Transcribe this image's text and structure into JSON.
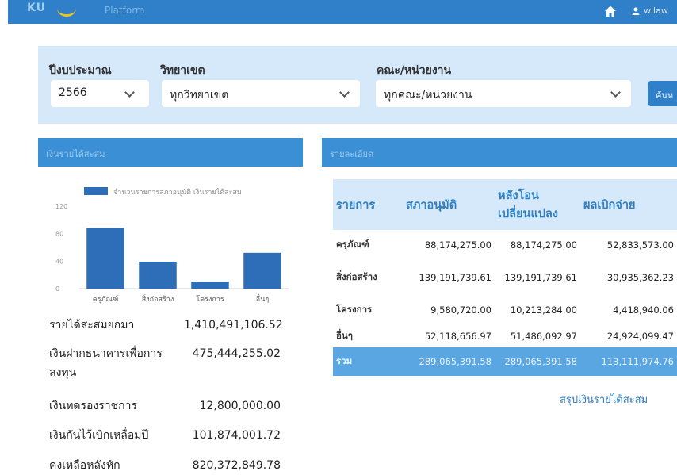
{
  "app": {
    "logo_text": "KU",
    "platform_label": "Platform",
    "user_name": "wilaw"
  },
  "filters": {
    "fiscal_year": {
      "label": "ปีงบประมาณ",
      "value": "2566"
    },
    "campus": {
      "label": "วิทยาเขต",
      "value": "ทุกวิทยาเขต"
    },
    "faculty": {
      "label": "คณะ/หน่วยงาน",
      "value": "ทุกคณะ/หน่วยงาน"
    },
    "search_label": "ค้นห"
  },
  "income_card": {
    "title": "เงินรายได้สะสม"
  },
  "detail_card": {
    "title": "รายละเอียด"
  },
  "chart_data": {
    "type": "bar",
    "categories": [
      "ครุภัณฑ์",
      "สิ่งก่อสร้าง",
      "โครงการ",
      "อื่นๆ"
    ],
    "series": [
      {
        "name": "จำนวนรายการสภาอนุมัติ เงินรายได้สะสม",
        "values": [
          88.17,
          39.19,
          10.21,
          52.12
        ]
      }
    ],
    "yticks": [
      "120",
      "80",
      "40",
      "0"
    ],
    "ylim": [
      0,
      120
    ],
    "legend_position": "top",
    "grid": false,
    "bar_color": "#2e6db8"
  },
  "summary": [
    {
      "label": "รายได้สะสมยกมา",
      "value": "1,410,491,106.52"
    },
    {
      "label": "เงินฝากธนาคารเพื่อการลงทุน",
      "value": "475,444,255.02"
    },
    {
      "label": "เงินทดรองราชการ",
      "value": "12,800,000.00"
    },
    {
      "label": "เงินกันไว้เบิกเหลื่อมปี",
      "value": "101,874,001.72"
    },
    {
      "label": "คงเหลือหลังหัก",
      "value": "820,372,849.78"
    }
  ],
  "table": {
    "headers": [
      "รายการ",
      "สภาอนุมัติ",
      "หลังโอนเปลี่ยนแปลง",
      "ผลเบิกจ่าย"
    ],
    "rows": [
      {
        "name": "ครุภัณฑ์",
        "approved": "88,174,275.00",
        "after_transfer": "88,174,275.00",
        "disbursed": "52,833,573.00"
      },
      {
        "name": "สิ่งก่อสร้าง",
        "approved": "139,191,739.61",
        "after_transfer": "139,191,739.61",
        "disbursed": "30,935,362.23"
      },
      {
        "name": "โครงการ",
        "approved": "9,580,720.00",
        "after_transfer": "10,213,284.00",
        "disbursed": "4,418,940.06"
      },
      {
        "name": "อื่นๆ",
        "approved": "52,118,656.97",
        "after_transfer": "51,486,092.97",
        "disbursed": "24,924,099.47"
      }
    ],
    "total": {
      "name": "รวม",
      "approved": "289,065,391.58",
      "after_transfer": "289,065,391.58",
      "disbursed": "113,111,974.76"
    }
  },
  "summary_link": "สรุปเงินรายได้สะสม"
}
